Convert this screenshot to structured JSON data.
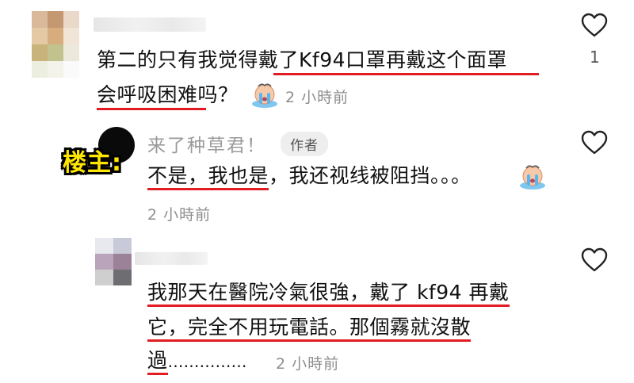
{
  "comments": [
    {
      "text_lines": [
        "第二的只有我觉得戴了Kf94口罩再戴这个面罩",
        "会呼吸困难吗？"
      ],
      "emoji": "crying-face-emoji",
      "time": "2 小時前",
      "like_count": "1"
    },
    {
      "reply_author_label": "楼主:",
      "username": "来了种草君！",
      "author_tag": "作者",
      "text_part1": "不是，我也是",
      "text_part2": "，我还视线被阻挡。。。",
      "emoji": "crying-face-emoji",
      "time": "2 小時前"
    },
    {
      "text_lines": [
        "我那天在醫院冷氣很強，戴了 kf94 再戴",
        "它，完全不用玩電話。那個霧就沒散",
        "過"
      ],
      "ellipsis": "……………",
      "time": "2 小時前"
    }
  ],
  "colors": {
    "underline": "#e31b23",
    "meta_text": "#8e8e8e",
    "label_fill": "#ffe600",
    "tag_bg": "#eeeeee"
  }
}
